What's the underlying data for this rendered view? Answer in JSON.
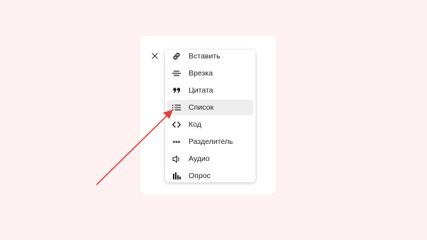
{
  "menu": {
    "items": [
      {
        "label": "Вставить",
        "icon": "link-icon"
      },
      {
        "label": "Врезка",
        "icon": "align-center-icon"
      },
      {
        "label": "Цитата",
        "icon": "quote-icon"
      },
      {
        "label": "Список",
        "icon": "list-icon",
        "selected": true
      },
      {
        "label": "Код",
        "icon": "code-icon"
      },
      {
        "label": "Разделитель",
        "icon": "asterisks-icon",
        "icon_text": "***"
      },
      {
        "label": "Аудио",
        "icon": "speaker-icon"
      },
      {
        "label": "Опрос",
        "icon": "bar-chart-icon"
      }
    ]
  },
  "close": {
    "icon": "close-icon",
    "glyph": "×"
  },
  "colors": {
    "background": "#fdf1f1",
    "selected": "#eeeeee",
    "annotation_arrow": "#e0403a"
  }
}
